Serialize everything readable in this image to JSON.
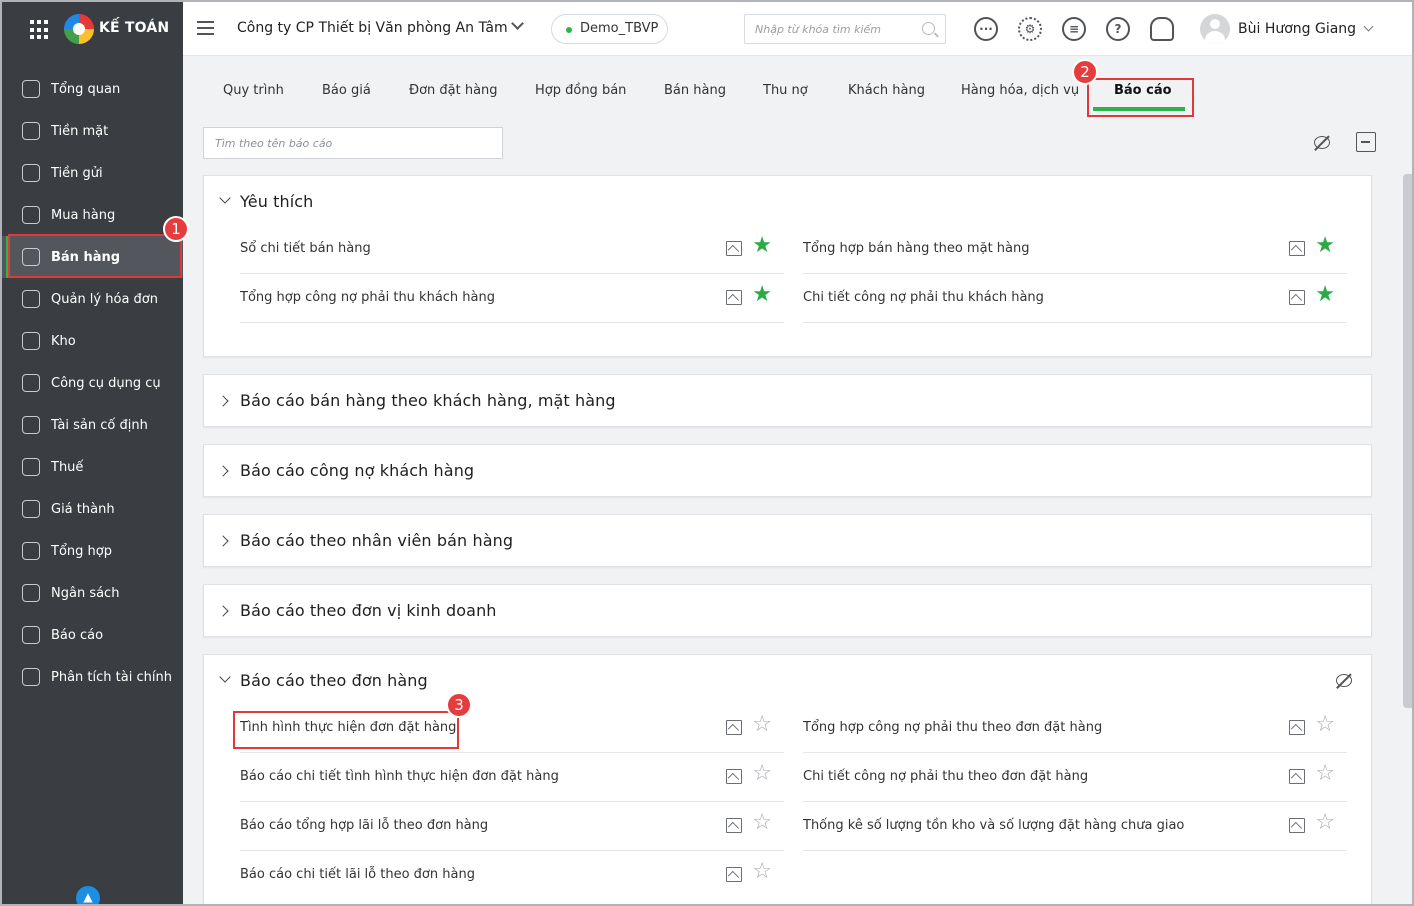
{
  "brand": {
    "name": "KẾ TOÁN"
  },
  "sidebar": {
    "items": [
      {
        "label": "Tổng quan",
        "icon": "dashboard-icon"
      },
      {
        "label": "Tiền mặt",
        "icon": "cash-icon"
      },
      {
        "label": "Tiền gửi",
        "icon": "bank-icon"
      },
      {
        "label": "Mua hàng",
        "icon": "purchase-bag-icon"
      },
      {
        "label": "Bán hàng",
        "icon": "cart-icon",
        "active": true
      },
      {
        "label": "Quản lý hóa đơn",
        "icon": "invoice-icon"
      },
      {
        "label": "Kho",
        "icon": "warehouse-icon"
      },
      {
        "label": "Công cụ dụng cụ",
        "icon": "tools-icon"
      },
      {
        "label": "Tài sản cố định",
        "icon": "fixed-asset-icon"
      },
      {
        "label": "Thuế",
        "icon": "tax-icon"
      },
      {
        "label": "Giá thành",
        "icon": "price-tag-icon"
      },
      {
        "label": "Tổng hợp",
        "icon": "summary-icon"
      },
      {
        "label": "Ngân sách",
        "icon": "budget-icon"
      },
      {
        "label": "Báo cáo",
        "icon": "report-chart-icon"
      },
      {
        "label": "Phân tích tài chính",
        "icon": "analytics-icon"
      }
    ]
  },
  "header": {
    "company": "Công ty CP Thiết bị Văn phòng An Tâm",
    "database": "Demo_TBVP",
    "search_placeholder": "Nhập từ khóa tìm kiếm",
    "user_name": "Bùi Hương Giang"
  },
  "tabs": [
    {
      "label": "Quy trình"
    },
    {
      "label": "Báo giá"
    },
    {
      "label": "Đơn đặt hàng"
    },
    {
      "label": "Hợp đồng bán"
    },
    {
      "label": "Bán hàng"
    },
    {
      "label": "Thu nợ"
    },
    {
      "label": "Khách hàng"
    },
    {
      "label": "Hàng hóa, dịch vụ"
    },
    {
      "label": "Báo cáo",
      "active": true
    }
  ],
  "report_search_placeholder": "Tìm theo tên báo cáo",
  "sections": {
    "favorites": {
      "title": "Yêu thích",
      "items": [
        "Sổ chi tiết bán hàng",
        "Tổng hợp bán hàng theo mặt hàng",
        "Tổng hợp công nợ phải thu khách hàng",
        "Chi tiết công nợ phải thu khách hàng"
      ]
    },
    "by_customer": {
      "title": "Báo cáo bán hàng theo khách hàng, mặt hàng"
    },
    "customer_debt": {
      "title": "Báo cáo công nợ khách hàng"
    },
    "by_staff": {
      "title": "Báo cáo theo nhân viên bán hàng"
    },
    "by_unit": {
      "title": "Báo cáo theo đơn vị kinh doanh"
    },
    "by_order": {
      "title": "Báo cáo theo đơn hàng",
      "items": [
        "Tình hình thực hiện đơn đặt hàng",
        "Tổng hợp công nợ phải thu theo đơn đặt hàng",
        "Báo cáo chi tiết tình hình thực hiện đơn đặt hàng",
        "Chi tiết công nợ phải thu theo đơn đặt hàng",
        "Báo cáo tổng hợp lãi lỗ theo đơn hàng",
        "Thống kê số lượng tồn kho và số lượng đặt hàng chưa giao",
        "Báo cáo chi tiết lãi lỗ theo đơn hàng"
      ]
    }
  },
  "annotations": {
    "step1": "1",
    "step2": "2",
    "step3": "3"
  },
  "colors": {
    "accent": "#2eb34a",
    "highlight": "#e0393b",
    "sidebar": "#3a3d42"
  }
}
